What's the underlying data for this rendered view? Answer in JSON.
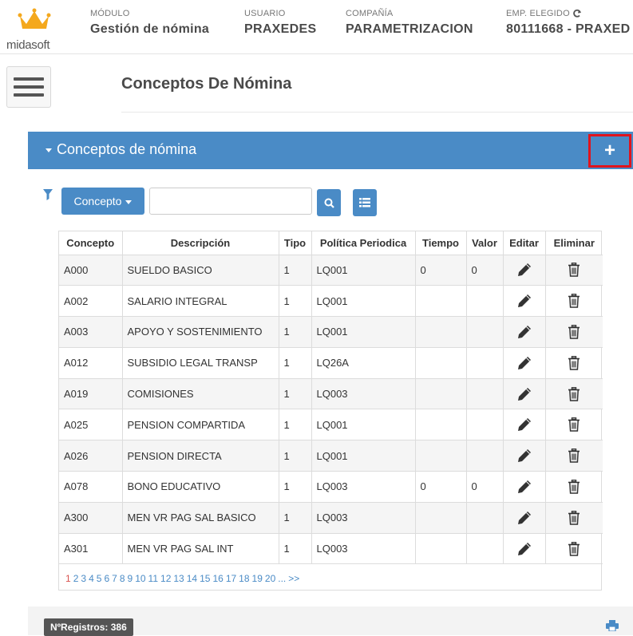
{
  "header": {
    "brand": "midasoft",
    "modulo_label": "MÓDULO",
    "modulo_value": "Gestión de nómina",
    "usuario_label": "USUARIO",
    "usuario_value": "PRAXEDES",
    "compania_label": "COMPAÑÍA",
    "compania_value": "PARAMETRIZACION",
    "empleado_label": "EMP. ELEGIDO",
    "empleado_value": "80111668 - PRAXED"
  },
  "page_title": "Conceptos De Nómina",
  "panel": {
    "title": "Conceptos de nómina",
    "add_label": "+"
  },
  "filter": {
    "dropdown_label": "Concepto",
    "search_value": "",
    "search_placeholder": ""
  },
  "table": {
    "columns": [
      "Concepto",
      "Descripción",
      "Tipo",
      "Política Periodica",
      "Tiempo",
      "Valor",
      "Editar",
      "Eliminar"
    ],
    "rows": [
      {
        "concepto": "A000",
        "descripcion": "SUELDO BASICO",
        "tipo": "1",
        "politica": "LQ001",
        "tiempo": "0",
        "valor": "0"
      },
      {
        "concepto": "A002",
        "descripcion": "SALARIO INTEGRAL",
        "tipo": "1",
        "politica": "LQ001",
        "tiempo": "",
        "valor": ""
      },
      {
        "concepto": "A003",
        "descripcion": "APOYO Y SOSTENIMIENTO",
        "tipo": "1",
        "politica": "LQ001",
        "tiempo": "",
        "valor": ""
      },
      {
        "concepto": "A012",
        "descripcion": "SUBSIDIO LEGAL TRANSP",
        "tipo": "1",
        "politica": "LQ26A",
        "tiempo": "",
        "valor": ""
      },
      {
        "concepto": "A019",
        "descripcion": "COMISIONES",
        "tipo": "1",
        "politica": "LQ003",
        "tiempo": "",
        "valor": ""
      },
      {
        "concepto": "A025",
        "descripcion": "PENSION COMPARTIDA",
        "tipo": "1",
        "politica": "LQ001",
        "tiempo": "",
        "valor": ""
      },
      {
        "concepto": "A026",
        "descripcion": "PENSION DIRECTA",
        "tipo": "1",
        "politica": "LQ001",
        "tiempo": "",
        "valor": ""
      },
      {
        "concepto": "A078",
        "descripcion": "BONO EDUCATIVO",
        "tipo": "1",
        "politica": "LQ003",
        "tiempo": "0",
        "valor": "0"
      },
      {
        "concepto": "A300",
        "descripcion": "MEN VR PAG SAL BASICO",
        "tipo": "1",
        "politica": "LQ003",
        "tiempo": "",
        "valor": ""
      },
      {
        "concepto": "A301",
        "descripcion": "MEN VR PAG SAL INT",
        "tipo": "1",
        "politica": "LQ003",
        "tiempo": "",
        "valor": ""
      }
    ]
  },
  "pagination": [
    "1",
    "2",
    "3",
    "4",
    "5",
    "6",
    "7",
    "8",
    "9",
    "10",
    "11",
    "12",
    "13",
    "14",
    "15",
    "16",
    "17",
    "18",
    "19",
    "20",
    "...",
    ">>"
  ],
  "footer": {
    "registros": "NºRegistros: 386"
  },
  "colors": {
    "accent": "#4a8bc6",
    "highlight": "#e0141d",
    "crown": "#f4a81d"
  },
  "icons": [
    "crown-logo-icon",
    "refresh-icon",
    "hamburger-menu-icon",
    "caret-down-icon",
    "plus-icon",
    "filter-icon",
    "search-icon",
    "list-icon",
    "pencil-icon",
    "trash-icon",
    "print-icon"
  ]
}
